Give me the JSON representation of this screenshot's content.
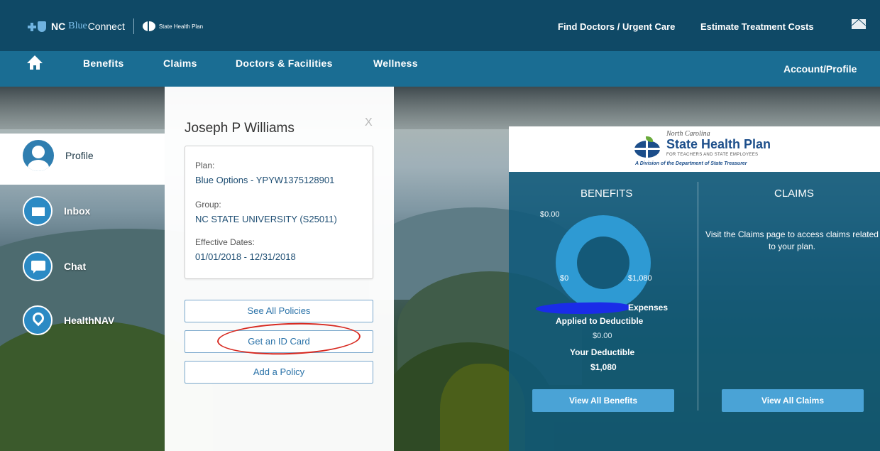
{
  "header": {
    "brand_nc": "NC",
    "brand_blue": "Blue",
    "brand_connect": "Connect",
    "state_health_plan_small": "State Health Plan",
    "links": [
      "Find Doctors / Urgent Care",
      "Estimate Treatment Costs"
    ],
    "mail_icon": "mail-icon"
  },
  "nav": {
    "items": [
      "Benefits",
      "Claims",
      "Doctors & Facilities",
      "Wellness"
    ],
    "account": "Account/Profile"
  },
  "sidebar": {
    "items": [
      {
        "label": "Profile",
        "icon": "person-icon"
      },
      {
        "label": "Inbox",
        "icon": "envelope-icon"
      },
      {
        "label": "Chat",
        "icon": "chat-icon"
      },
      {
        "label": "HealthNAV",
        "icon": "location-pin-icon"
      }
    ]
  },
  "profile_card": {
    "name": "Joseph P Williams",
    "close": "X",
    "plan_label": "Plan:",
    "plan_value": "Blue Options - YPYW1375128901",
    "group_label": "Group:",
    "group_value": "NC STATE UNIVERSITY (S25011)",
    "dates_label": "Effective Dates:",
    "dates_value": "01/01/2018 - 12/31/2018",
    "buttons": [
      "See All Policies",
      "Get an ID Card",
      "Add a Policy"
    ]
  },
  "plan_logo": {
    "north_carolina": "North Carolina",
    "title": "State Health Plan",
    "subtitle": "FOR TEACHERS AND STATE EMPLOYEES",
    "division": "A Division of the Department of State Treasurer"
  },
  "benefits": {
    "title": "BENEFITS",
    "gauge_top": "$0.00",
    "gauge_min": "$0",
    "gauge_max": "$1,080",
    "expenses_label": "Expenses",
    "applied_label": "Applied to Deductible",
    "applied_value": "$0.00",
    "deductible_label": "Your Deductible",
    "deductible_value": "$1,080",
    "button": "View All Benefits"
  },
  "claims": {
    "title": "CLAIMS",
    "text": "Visit the Claims page to access claims related to your plan.",
    "button": "View All Claims"
  }
}
